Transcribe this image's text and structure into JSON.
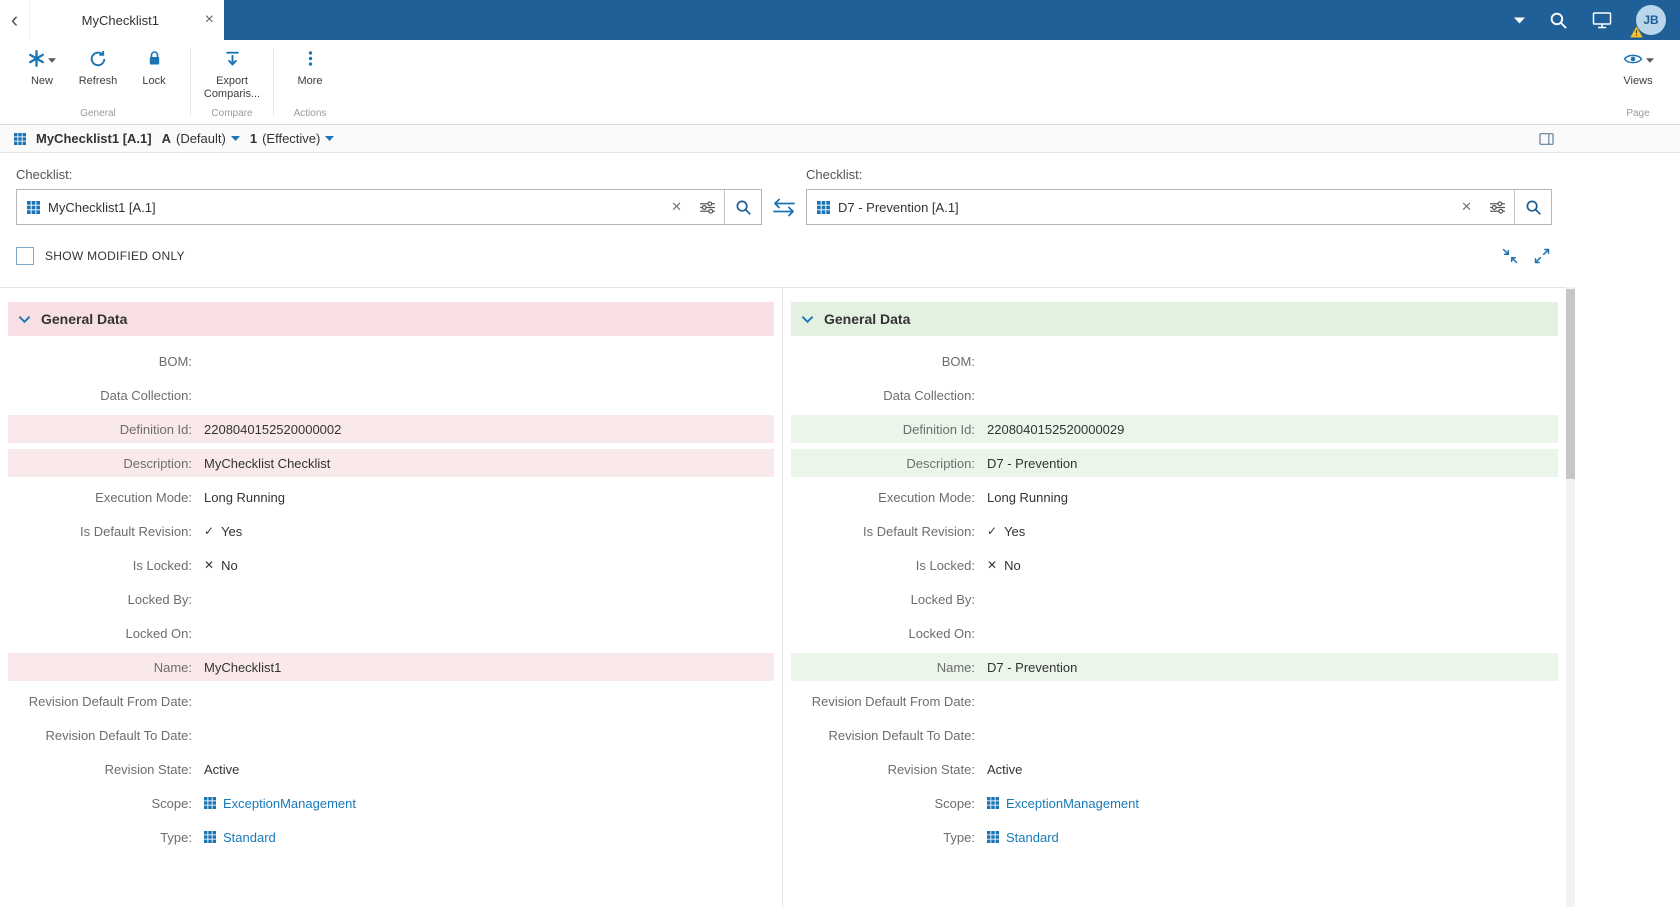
{
  "colors": {
    "topbar": "#1e6097",
    "accent": "#1b75b5",
    "link": "#187aba",
    "pink_header": "#f8dfe3",
    "pink_row": "#fae9eb",
    "green_header": "#e2f1e0",
    "green_row": "#eaf6e9"
  },
  "glyphs": {
    "back": "‹",
    "close": "×",
    "clear": "✕",
    "check": "✓",
    "cross": "✕"
  },
  "topbar": {
    "tab_title": "MyChecklist1",
    "avatar_initials": "JB"
  },
  "ribbon": {
    "buttons": {
      "new": "New",
      "refresh": "Refresh",
      "lock": "Lock",
      "export_line1": "Export",
      "export_line2": "Comparis...",
      "more": "More",
      "views": "Views"
    },
    "group_labels": {
      "general": "General",
      "compare": "Compare",
      "actions": "Actions",
      "page": "Page"
    }
  },
  "breadcrumb": {
    "title": "MyChecklist1 [A.1]",
    "revision_letter": "A",
    "revision_label": "(Default)",
    "version_number": "1",
    "version_label": "(Effective)"
  },
  "pickers": {
    "left_label": "Checklist:",
    "left_value": "MyChecklist1 [A.1]",
    "right_label": "Checklist:",
    "right_value": "D7 - Prevention [A.1]"
  },
  "filters": {
    "show_modified_only": "SHOW MODIFIED ONLY"
  },
  "panels": {
    "left": {
      "section_title": "General Data",
      "fields": [
        {
          "label": "BOM:",
          "value": ""
        },
        {
          "label": "Data Collection:",
          "value": ""
        },
        {
          "label": "Definition Id:",
          "value": "2208040152520000002",
          "highlight": true
        },
        {
          "label": "Description:",
          "value": "MyChecklist Checklist",
          "highlight": true
        },
        {
          "label": "Execution Mode:",
          "value": "Long Running"
        },
        {
          "label": "Is Default Revision:",
          "value": "Yes",
          "icon": "check"
        },
        {
          "label": "Is Locked:",
          "value": "No",
          "icon": "cross"
        },
        {
          "label": "Locked By:",
          "value": ""
        },
        {
          "label": "Locked On:",
          "value": ""
        },
        {
          "label": "Name:",
          "value": "MyChecklist1",
          "highlight": true
        },
        {
          "label": "Revision Default From Date:",
          "value": ""
        },
        {
          "label": "Revision Default To Date:",
          "value": ""
        },
        {
          "label": "Revision State:",
          "value": "Active"
        },
        {
          "label": "Scope:",
          "value": "ExceptionManagement",
          "icon": "grid",
          "link": true
        },
        {
          "label": "Type:",
          "value": "Standard",
          "icon": "grid",
          "link": true
        }
      ]
    },
    "right": {
      "section_title": "General Data",
      "fields": [
        {
          "label": "BOM:",
          "value": ""
        },
        {
          "label": "Data Collection:",
          "value": ""
        },
        {
          "label": "Definition Id:",
          "value": "2208040152520000029",
          "highlight": true
        },
        {
          "label": "Description:",
          "value": "D7 - Prevention",
          "highlight": true
        },
        {
          "label": "Execution Mode:",
          "value": "Long Running"
        },
        {
          "label": "Is Default Revision:",
          "value": "Yes",
          "icon": "check"
        },
        {
          "label": "Is Locked:",
          "value": "No",
          "icon": "cross"
        },
        {
          "label": "Locked By:",
          "value": ""
        },
        {
          "label": "Locked On:",
          "value": ""
        },
        {
          "label": "Name:",
          "value": "D7 - Prevention",
          "highlight": true
        },
        {
          "label": "Revision Default From Date:",
          "value": ""
        },
        {
          "label": "Revision Default To Date:",
          "value": ""
        },
        {
          "label": "Revision State:",
          "value": "Active"
        },
        {
          "label": "Scope:",
          "value": "ExceptionManagement",
          "icon": "grid",
          "link": true
        },
        {
          "label": "Type:",
          "value": "Standard",
          "icon": "grid",
          "link": true
        }
      ]
    }
  }
}
